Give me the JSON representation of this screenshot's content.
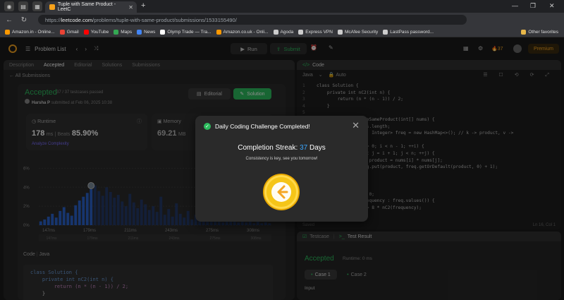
{
  "browser": {
    "tab_title": "Tuple with Same Product - LeetC",
    "url_prefix": "https://",
    "url_host": "leetcode.com",
    "url_path": "/problems/tuple-with-same-product/submissions/1533155490/",
    "bookmarks": [
      {
        "label": "Amazon.in - Online...",
        "color": "#ff9900"
      },
      {
        "label": "Gmail",
        "color": "#ea4335"
      },
      {
        "label": "YouTube",
        "color": "#ff0000"
      },
      {
        "label": "Maps",
        "color": "#34a853"
      },
      {
        "label": "News",
        "color": "#4285f4"
      },
      {
        "label": "Olymp Trade — Tra...",
        "color": "#ffffff"
      },
      {
        "label": "Amazon.co.uk - Onli...",
        "color": "#ff9900"
      },
      {
        "label": "Agoda",
        "color": "#cccccc"
      },
      {
        "label": "Express VPN",
        "color": "#cccccc"
      },
      {
        "label": "McAfee Security",
        "color": "#cccccc"
      },
      {
        "label": "LastPass password...",
        "color": "#cccccc"
      }
    ],
    "other_favorites": "Other favorites"
  },
  "lc_nav": {
    "problem_list": "Problem List",
    "run": "Run",
    "submit": "Submit",
    "streak_count": "37",
    "premium": "Premium"
  },
  "left_panel": {
    "tabs": [
      "Description",
      "Accepted",
      "Editorial",
      "Solutions",
      "Submissions"
    ],
    "all_submissions": "All Submissions",
    "status": "Accepted",
    "passed": "37 / 37 testcases passed",
    "author": "Harsha P",
    "submitted_at": "submitted at Feb 06, 2025 10:38",
    "editorial_btn": "Editorial",
    "solution_btn": "Solution",
    "runtime_label": "Runtime",
    "runtime_value": "178",
    "runtime_unit": "ms",
    "beats_label": "Beats",
    "beats_value": "85.90%",
    "memory_label": "Memory",
    "memory_value": "69.21",
    "memory_unit": "MB",
    "analyze": "Analyze Complexity",
    "code_label": "Code",
    "code_lang": "Java",
    "code_lines": [
      "class Solution {",
      "    private int nC2(int n) {",
      "        return (n * (n - 1)) / 2;",
      "    }"
    ]
  },
  "chart_data": {
    "type": "bar",
    "title": "",
    "ylabel": "",
    "y_ticks": [
      "6%",
      "4%",
      "2%",
      "0%"
    ],
    "x_ticks": [
      "147ms",
      "179ms",
      "211ms",
      "243ms",
      "275ms",
      "308ms"
    ],
    "ylim": [
      0,
      7
    ],
    "values": [
      0.4,
      0.6,
      0.9,
      1.2,
      0.8,
      1.5,
      1.9,
      1.3,
      1.0,
      2.1,
      2.6,
      3.0,
      3.4,
      3.8,
      4.2,
      3.6,
      3.1,
      4.0,
      3.5,
      2.9,
      3.2,
      2.5,
      2.0,
      3.3,
      2.4,
      1.8,
      2.7,
      2.2,
      1.6,
      2.0,
      1.4,
      3.0,
      1.1,
      1.7,
      0.9,
      2.3,
      1.2,
      0.8,
      1.5,
      0.6,
      1.1,
      0.7,
      1.9,
      0.5,
      0.9,
      0.4,
      0.8,
      0.3,
      0.7,
      0.5,
      0.4,
      0.3,
      0.6,
      0.3,
      0.5,
      0.2,
      0.4,
      0.2,
      0.3,
      0.2
    ],
    "highlight_index": 13
  },
  "right_panel": {
    "code_title": "Code",
    "lang": "Java",
    "auto": "Auto",
    "lines": [
      "class Solution {",
      "    private int nC2(int n) {",
      "        return (n * (n - 1)) / 2;",
      "    }",
      "",
      "    public int tupleSameProduct(int[] nums) {",
      "        int n = nums.length;",
      "        Map<Integer, Integer> freq = new HashMap<>(); // k -> product, v ->",
      "",
      "        for (int i = 0; i < n - 1; ++i) {",
      "            for (int j = i + 1; j < n; ++j) {",
      "                int product = nums[i] * nums[j];",
      "                freq.put(product, freq.getOrDefault(product, 0) + 1);",
      "            }",
      "        }",
      "",
      "        int count = 0;",
      "        for (int frequency : freq.values()) {",
      "            count += 8 * nC2(frequency);"
    ],
    "status_left": "Saved",
    "status_right": "Ln 16, Col 1"
  },
  "test_panel": {
    "tab_testcase": "Testcase",
    "tab_result": "Test Result",
    "status": "Accepted",
    "runtime": "Runtime: 0 ms",
    "cases": [
      "Case 1",
      "Case 2"
    ],
    "input_label": "Input"
  },
  "modal": {
    "title": "Daily Coding Challenge Completed!",
    "streak_label": "Completion Streak:",
    "streak_num": "37",
    "streak_unit": "Days",
    "subtitle": "Consistency is key, see you tomorrow!"
  }
}
